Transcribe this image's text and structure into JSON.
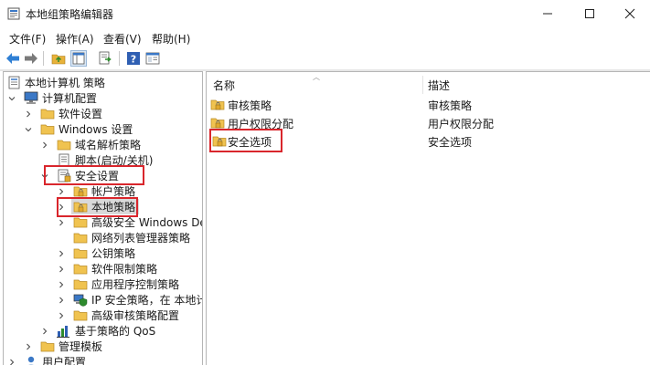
{
  "window": {
    "title": "本地组策略编辑器",
    "minimize": "—",
    "maximize": "☐",
    "close": "✕"
  },
  "menu": [
    "文件(F)",
    "操作(A)",
    "查看(V)",
    "帮助(H)"
  ],
  "toolbar": {
    "buttons": [
      "back-icon",
      "forward-icon",
      "up-folder-icon",
      "show-hide-tree-icon",
      "export-list-icon",
      "help-icon",
      "properties-icon"
    ]
  },
  "tree": {
    "items": [
      {
        "label": "本地计算机 策略",
        "icon": "computer-policy-icon"
      },
      {
        "label": "计算机配置",
        "icon": "computer-icon"
      },
      {
        "label": "软件设置",
        "icon": "folder-icon"
      },
      {
        "label": "Windows 设置",
        "icon": "folder-icon"
      },
      {
        "label": "域名解析策略",
        "icon": "folder-icon"
      },
      {
        "label": "脚本(启动/关机)",
        "icon": "script-icon"
      },
      {
        "label": "安全设置",
        "icon": "security-settings-icon"
      },
      {
        "label": "帐户策略",
        "icon": "folder-icon"
      },
      {
        "label": "本地策略",
        "icon": "folder-icon"
      },
      {
        "label": "高级安全 Windows Defe",
        "icon": "folder-icon"
      },
      {
        "label": "网络列表管理器策略",
        "icon": "folder-icon"
      },
      {
        "label": "公钥策略",
        "icon": "folder-icon"
      },
      {
        "label": "软件限制策略",
        "icon": "folder-icon"
      },
      {
        "label": "应用程序控制策略",
        "icon": "folder-icon"
      },
      {
        "label": "IP 安全策略，在 本地计算",
        "icon": "ip-security-icon"
      },
      {
        "label": "高级审核策略配置",
        "icon": "folder-icon"
      },
      {
        "label": "基于策略的 QoS",
        "icon": "qos-chart-icon"
      },
      {
        "label": "管理模板",
        "icon": "folder-icon"
      },
      {
        "label": "用户配置",
        "icon": "user-icon"
      }
    ]
  },
  "list": {
    "columns": [
      "名称",
      "描述"
    ],
    "rows": [
      {
        "name": "审核策略",
        "description": "审核策略"
      },
      {
        "name": "用户权限分配",
        "description": "用户权限分配"
      },
      {
        "name": "安全选项",
        "description": "安全选项"
      }
    ]
  },
  "colors": {
    "highlight_border": "#d9262c",
    "folder_yellow": "#e8b23a",
    "selection_bg": "#d9d9d9"
  }
}
